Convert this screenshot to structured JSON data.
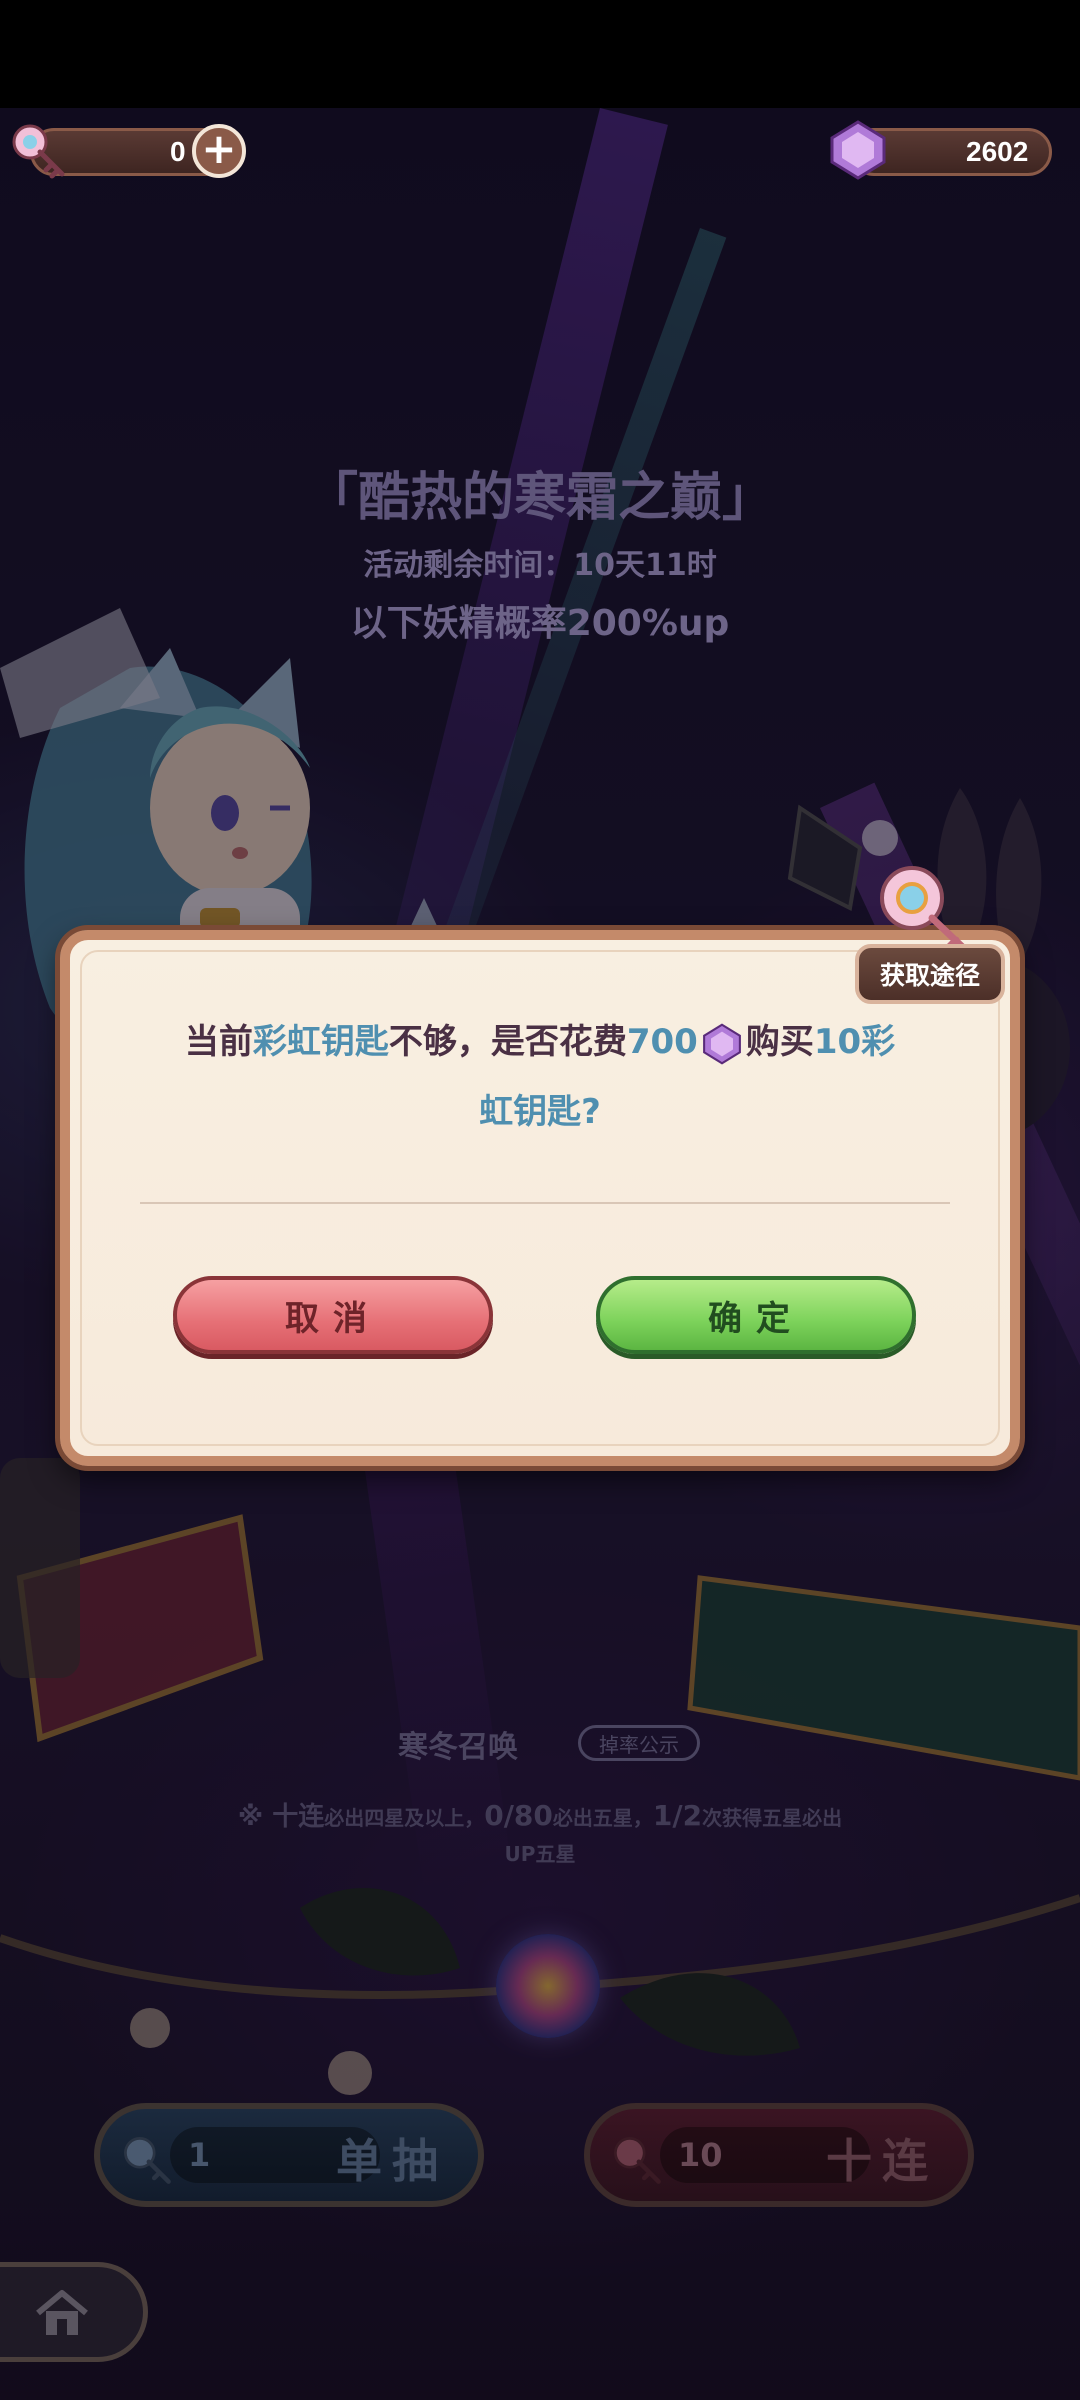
{
  "top_bar": {
    "rainbow_key_count": "0",
    "gem_count": "2602"
  },
  "event": {
    "title": "「酷热的寒霜之巅」",
    "time_remaining": "活动剩余时间：10天11时",
    "rate_up_text": "以下妖精概率200%up"
  },
  "dialog": {
    "acquire_button": "获取途径",
    "message_part1": "当前",
    "message_key_name": "彩虹钥匙",
    "message_part2": "不够，是否花费",
    "message_cost": "700",
    "message_part3": "购买",
    "message_qty": "10彩",
    "message_line2": "虹钥匙?",
    "cancel_label": "取消",
    "confirm_label": "确定"
  },
  "summon": {
    "pool_name": "寒冬召唤",
    "rate_button": "掉率公示",
    "rule_line1_a": "※ 十连",
    "rule_line1_b": "必出四星及以上，",
    "rule_line1_c": "0/80",
    "rule_line1_d": "必出五星，",
    "rule_line1_e": "1/2",
    "rule_line1_f": "次获得五星必出",
    "rule_line2": "UP五星",
    "single_count": "1",
    "single_label": "单抽",
    "ten_count": "10",
    "ten_label": "十连"
  },
  "colors": {
    "highlight": "#4f8fb0",
    "message_text": "#4a3044",
    "modal_border": "#c48a6a"
  },
  "icons": [
    "rainbow-key-icon",
    "plus-icon",
    "gem-icon",
    "home-icon"
  ]
}
